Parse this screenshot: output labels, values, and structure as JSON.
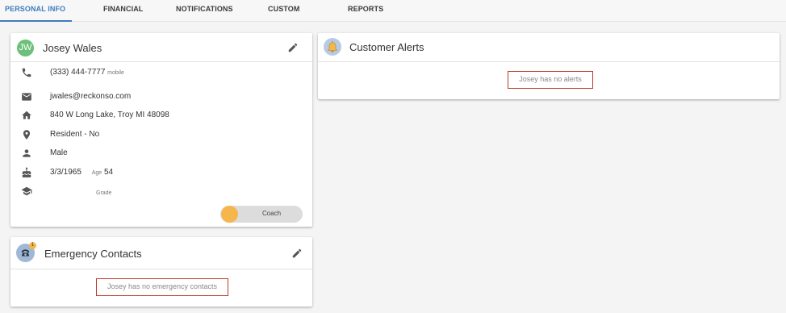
{
  "tabs": [
    {
      "label": "PERSONAL INFO",
      "active": true
    },
    {
      "label": "FINANCIAL",
      "active": false
    },
    {
      "label": "NOTIFICATIONS",
      "active": false
    },
    {
      "label": "CUSTOM",
      "active": false
    },
    {
      "label": "REPORTS",
      "active": false
    }
  ],
  "profile": {
    "initials": "JW",
    "name": "Josey Wales",
    "phone": "(333) 444-7777",
    "phone_type": "mobile",
    "email": "jwales@reckonso.com",
    "address": "840 W Long Lake, Troy MI 48098",
    "residency": "Resident - No",
    "gender": "Male",
    "birthdate": "3/3/1965",
    "age_label": "Age",
    "age": "54",
    "grade_label": "Grade",
    "coach_label": "Coach"
  },
  "emergency": {
    "title": "Emergency Contacts",
    "badge": "1",
    "empty_message": "Josey has no emergency contacts"
  },
  "alerts": {
    "title": "Customer Alerts",
    "empty_message": "Josey has no alerts"
  },
  "colors": {
    "accent": "#3f7cbf",
    "avatar": "#6cc07a",
    "coach_knob": "#f5b74b",
    "alert_border": "#c0392b"
  }
}
